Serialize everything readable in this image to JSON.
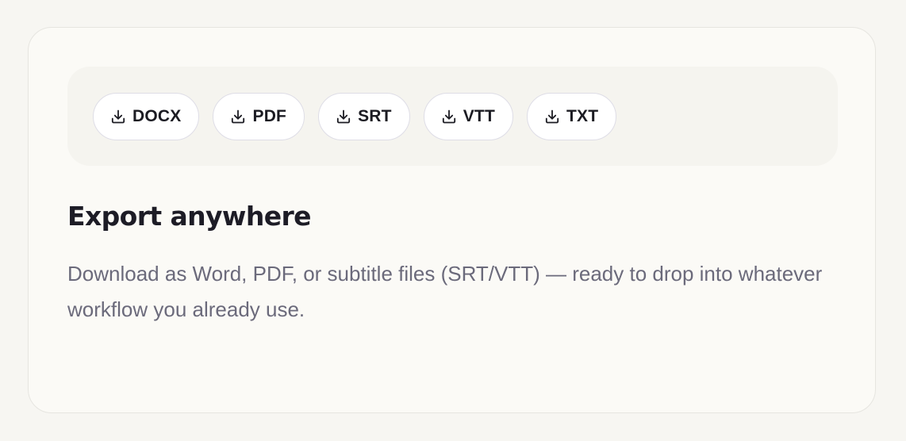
{
  "export_card": {
    "formats": [
      {
        "label": "DOCX",
        "icon": "download-icon"
      },
      {
        "label": "PDF",
        "icon": "download-icon"
      },
      {
        "label": "SRT",
        "icon": "download-icon"
      },
      {
        "label": "VTT",
        "icon": "download-icon"
      },
      {
        "label": "TXT",
        "icon": "download-icon"
      }
    ],
    "title": "Export anywhere",
    "description": "Download as Word, PDF, or subtitle files (SRT/VTT) — ready to drop into whatever workflow you already use."
  },
  "colors": {
    "page_background": "#f7f6f2",
    "card_background": "#fbfaf6",
    "strip_background": "#f5f4ef",
    "button_border": "#dedde6",
    "title_text": "#1d1c26",
    "body_text": "#6b6a7b"
  }
}
